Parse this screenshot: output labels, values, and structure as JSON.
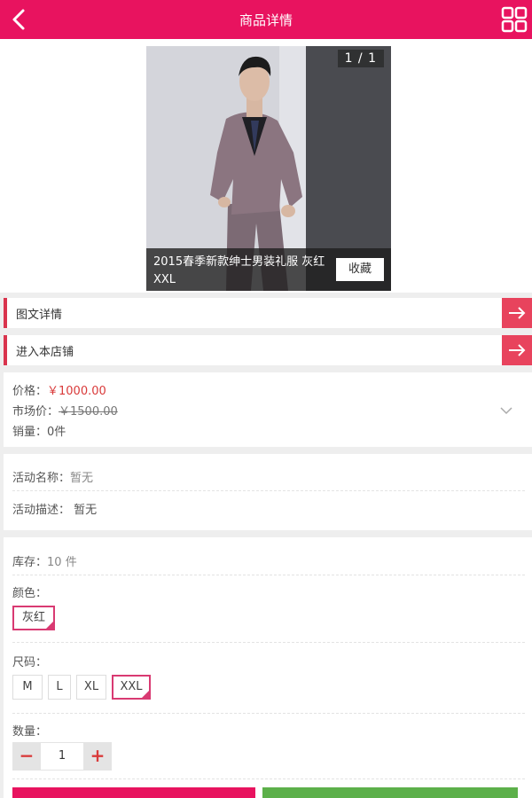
{
  "header": {
    "title": "商品详情"
  },
  "gallery": {
    "counter": "1 / 1",
    "caption": "2015春季新款绅士男装礼服 灰红 XXL",
    "favorite_label": "收藏"
  },
  "links": {
    "detail_label": "图文详情",
    "store_label": "进入本店铺"
  },
  "price": {
    "price_label": "价格：",
    "price_value": "￥1000.00",
    "market_label": "市场价：",
    "market_value": "￥1500.00",
    "sales_label": "销量：",
    "sales_value": "0件"
  },
  "activity": {
    "name_label": "活动名称：",
    "name_value": "暂无",
    "desc_label": "活动描述：",
    "desc_value": "暂无"
  },
  "options": {
    "stock_label": "库存：",
    "stock_value": "10 件",
    "color_label": "颜色：",
    "colors": [
      "灰红"
    ],
    "size_label": "尺码：",
    "sizes": [
      "M",
      "L",
      "XL",
      "XXL"
    ],
    "quantity_label": "数量：",
    "quantity_value": "1",
    "minus": "−",
    "plus": "+"
  },
  "colors": {
    "brand": "#e8135f",
    "accent_red": "#d93a3a",
    "green": "#5cb04a"
  }
}
